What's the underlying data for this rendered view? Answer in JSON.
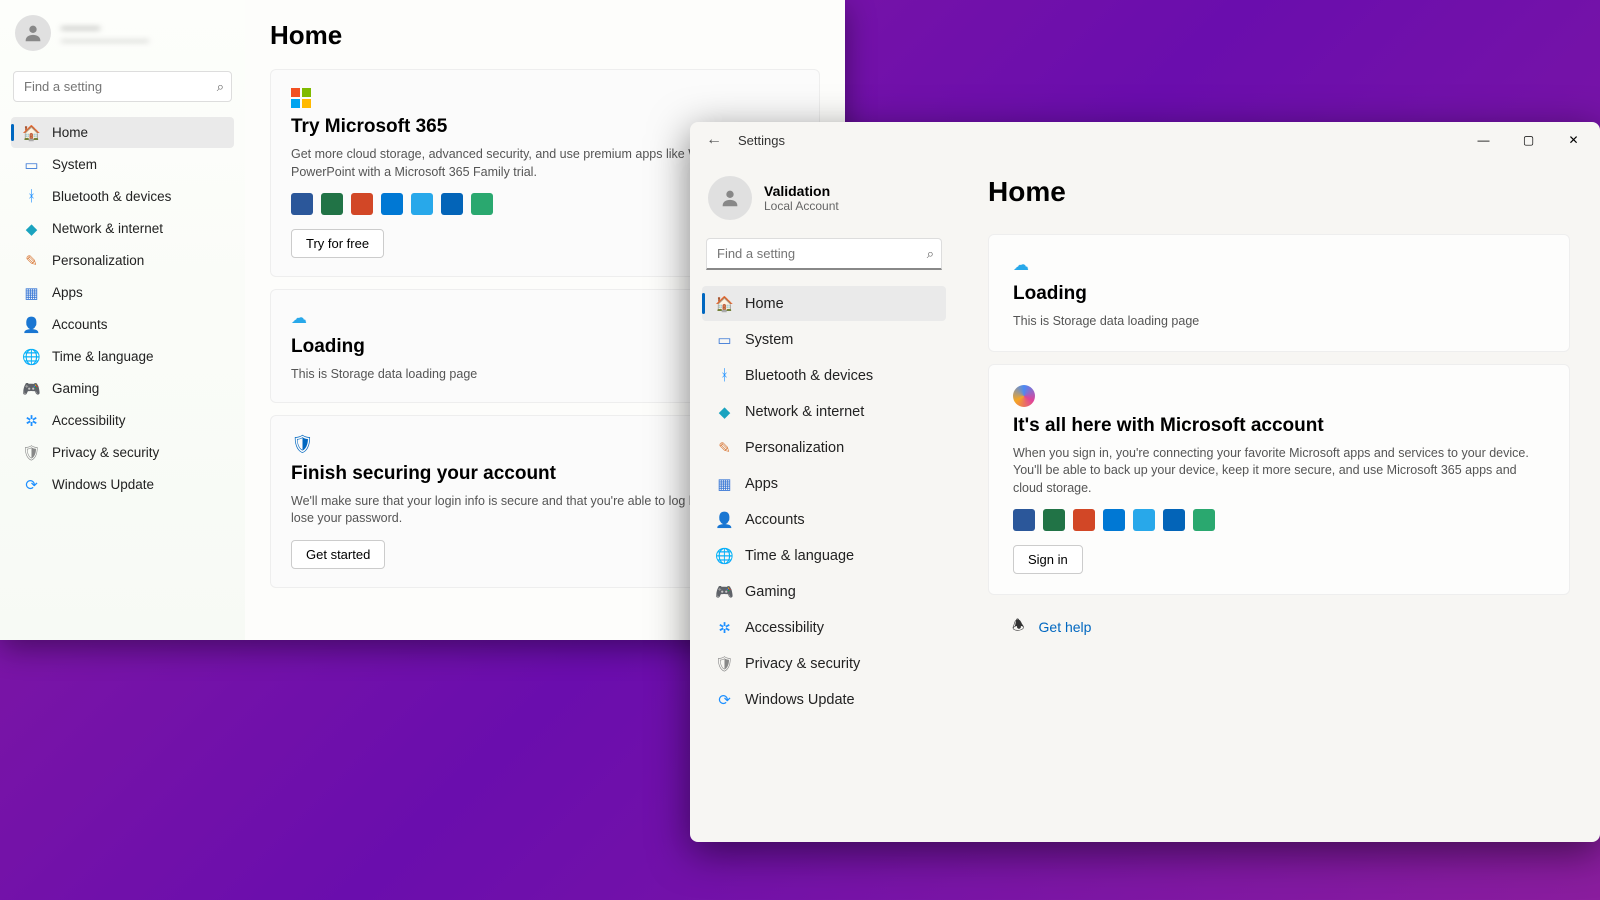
{
  "window1": {
    "account": {
      "name_blur": "———",
      "email_blur": "————————"
    },
    "search_placeholder": "Find a setting",
    "page_title": "Home",
    "nav": [
      {
        "icon": "home",
        "label": "Home",
        "selected": true,
        "color": "#e8a33d"
      },
      {
        "icon": "system",
        "label": "System",
        "selected": false,
        "color": "#3a78d6"
      },
      {
        "icon": "bluetooth",
        "label": "Bluetooth & devices",
        "selected": false,
        "color": "#1e90ff"
      },
      {
        "icon": "network",
        "label": "Network & internet",
        "selected": false,
        "color": "#1aa3bf"
      },
      {
        "icon": "personalization",
        "label": "Personalization",
        "selected": false,
        "color": "#d97a3a"
      },
      {
        "icon": "apps",
        "label": "Apps",
        "selected": false,
        "color": "#3a78d6"
      },
      {
        "icon": "accounts",
        "label": "Accounts",
        "selected": false,
        "color": "#2aa86f"
      },
      {
        "icon": "time",
        "label": "Time & language",
        "selected": false,
        "color": "#3a78d6"
      },
      {
        "icon": "gaming",
        "label": "Gaming",
        "selected": false,
        "color": "#777"
      },
      {
        "icon": "accessibility",
        "label": "Accessibility",
        "selected": false,
        "color": "#1e90ff"
      },
      {
        "icon": "privacy",
        "label": "Privacy & security",
        "selected": false,
        "color": "#888"
      },
      {
        "icon": "update",
        "label": "Windows Update",
        "selected": false,
        "color": "#1e90ff"
      }
    ],
    "cards": {
      "m365": {
        "title": "Try Microsoft 365",
        "desc": "Get more cloud storage, advanced security, and use premium apps like Word, Excel, and PowerPoint with a Microsoft 365 Family trial.",
        "button": "Try for free"
      },
      "loading": {
        "title": "Loading",
        "desc": "This is Storage data loading page"
      },
      "secure": {
        "title": "Finish securing your account",
        "desc": "We'll make sure that your login info is secure and that you're able to log back in if you ever lose your password.",
        "button": "Get started"
      }
    },
    "app_icon_colors": [
      "#2b579a",
      "#217346",
      "#d24726",
      "#0078d4",
      "#28a8ea",
      "#0364b8",
      "#2aa86f"
    ]
  },
  "window2": {
    "titlebar": {
      "back": "←",
      "title": "Settings",
      "min": "—",
      "max": "▢",
      "close": "✕"
    },
    "account": {
      "name": "Validation",
      "sub": "Local Account"
    },
    "search_placeholder": "Find a setting",
    "page_title": "Home",
    "nav": [
      {
        "icon": "home",
        "label": "Home",
        "selected": true,
        "color": "#e8a33d"
      },
      {
        "icon": "system",
        "label": "System",
        "selected": false,
        "color": "#3a78d6"
      },
      {
        "icon": "bluetooth",
        "label": "Bluetooth & devices",
        "selected": false,
        "color": "#1e90ff"
      },
      {
        "icon": "network",
        "label": "Network & internet",
        "selected": false,
        "color": "#1aa3bf"
      },
      {
        "icon": "personalization",
        "label": "Personalization",
        "selected": false,
        "color": "#d97a3a"
      },
      {
        "icon": "apps",
        "label": "Apps",
        "selected": false,
        "color": "#3a78d6"
      },
      {
        "icon": "accounts",
        "label": "Accounts",
        "selected": false,
        "color": "#2aa86f"
      },
      {
        "icon": "time",
        "label": "Time & language",
        "selected": false,
        "color": "#3a78d6"
      },
      {
        "icon": "gaming",
        "label": "Gaming",
        "selected": false,
        "color": "#777"
      },
      {
        "icon": "accessibility",
        "label": "Accessibility",
        "selected": false,
        "color": "#1e90ff"
      },
      {
        "icon": "privacy",
        "label": "Privacy & security",
        "selected": false,
        "color": "#888"
      },
      {
        "icon": "update",
        "label": "Windows Update",
        "selected": false,
        "color": "#1e90ff"
      }
    ],
    "cards": {
      "loading": {
        "title": "Loading",
        "desc": "This is Storage data loading page"
      },
      "msaccount": {
        "title": "It's all here with Microsoft account",
        "desc": "When you sign in, you're connecting your favorite Microsoft apps and services to your device. You'll be able to back up your device, keep it more secure, and use Microsoft 365 apps and cloud storage.",
        "button": "Sign in"
      }
    },
    "help_link": "Get help",
    "app_icon_colors": [
      "#2b579a",
      "#217346",
      "#d24726",
      "#0078d4",
      "#28a8ea",
      "#0364b8",
      "#2aa86f"
    ]
  },
  "nav_glyphs": {
    "home": "🏠",
    "system": "▭",
    "bluetooth": "ᚼ",
    "network": "◆",
    "personalization": "✎",
    "apps": "▦",
    "accounts": "👤",
    "time": "🌐",
    "gaming": "🎮",
    "accessibility": "✲",
    "privacy": "🛡",
    "update": "⟳"
  }
}
